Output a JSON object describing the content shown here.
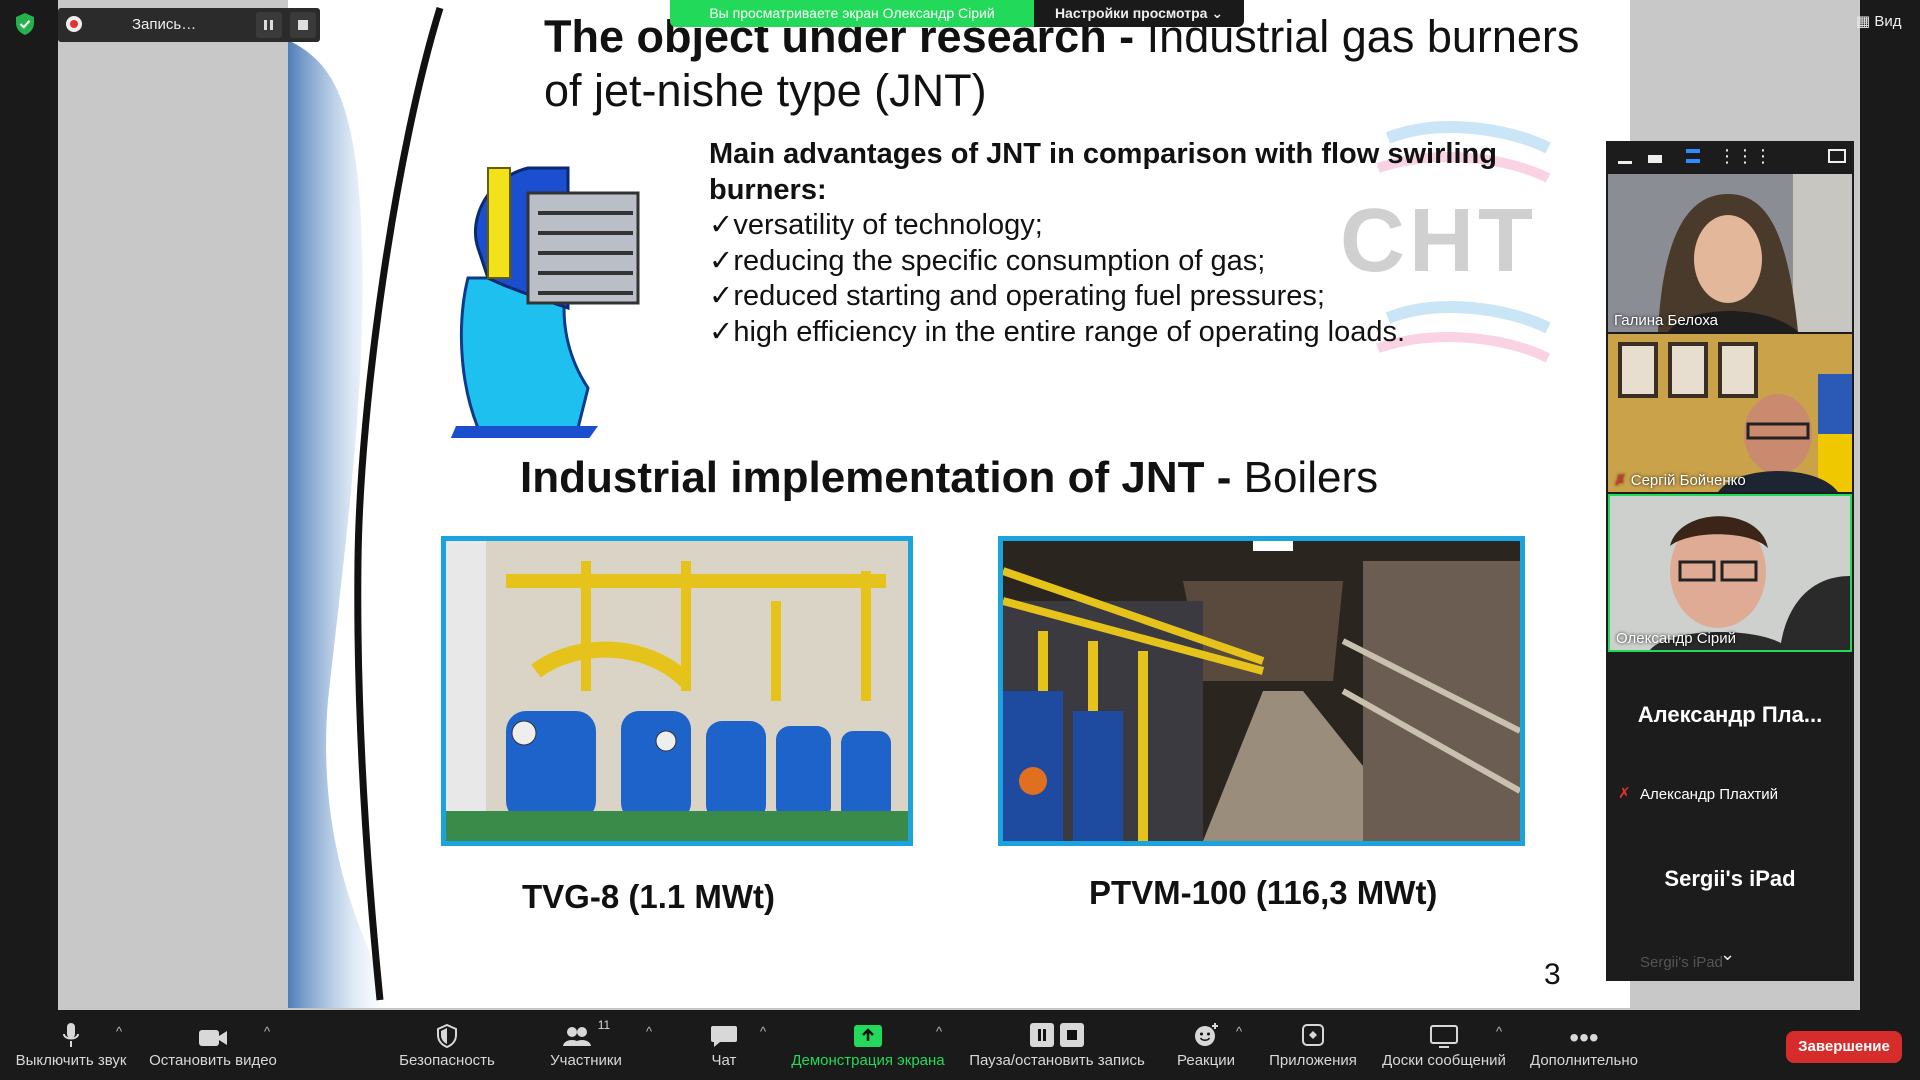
{
  "top": {
    "recording_label": "Запись…",
    "share_banner": "Вы просматриваете экран Олександр Сірий",
    "view_options": "Настройки просмотра",
    "view_button": "Вид"
  },
  "slide": {
    "title_bold": "The object under research -",
    "title_rest": " Industrial gas burners of jet-nishe type (JNT)",
    "adv_heading": "Main advantages of JNT in comparison with flow swirling burners:",
    "advantages": [
      "versatility of technology;",
      "reducing the specific consumption of gas;",
      "reduced starting and operating fuel pressures;",
      "high efficiency in the entire range of operating loads."
    ],
    "impl_bold": "Industrial implementation of JNT -",
    "impl_rest": " Boilers",
    "caption1": "TVG-8 (1.1 MWt)",
    "caption2": "PTVM-100 (116,3 MWt)",
    "page_number": "3",
    "logo_text": "CHT"
  },
  "participants": [
    {
      "name": "Галина Белоха",
      "muted": false
    },
    {
      "name": "Сергій Бойченко",
      "muted": true
    },
    {
      "name": "Олександр Сірий",
      "muted": false,
      "active": true
    },
    {
      "display": "Александр  Пла...",
      "name": "Александр Плахтий",
      "muted": true
    },
    {
      "display": "Sergii's iPad",
      "name": "Sergii's iPad",
      "muted": false
    }
  ],
  "toolbar": {
    "mute": "Выключить звук",
    "video": "Остановить видео",
    "security": "Безопасность",
    "participants": "Участники",
    "participants_count": "11",
    "chat": "Чат",
    "share": "Демонстрация экрана",
    "record": "Пауза/остановить запись",
    "reactions": "Реакции",
    "apps": "Приложения",
    "whiteboards": "Доски сообщений",
    "more": "Дополнительно",
    "end": "Завершение"
  },
  "colors": {
    "accent_green": "#23d959",
    "end_red": "#d62c2c",
    "photo_border": "#1aa3dc"
  }
}
